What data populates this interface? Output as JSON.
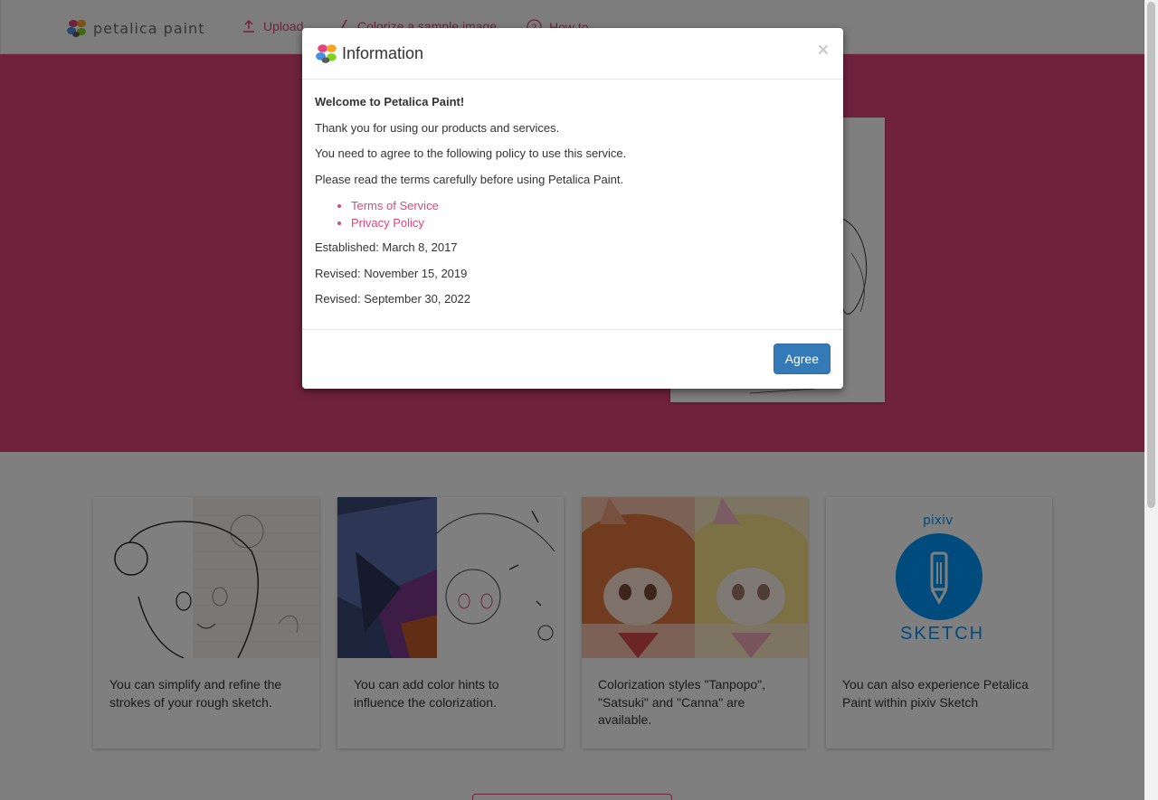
{
  "navbar": {
    "brand": "petalica paint",
    "items": [
      {
        "label": "Upload",
        "icon": "upload-icon"
      },
      {
        "label": "Colorize a sample image",
        "icon": "pencil-icon"
      },
      {
        "label": "How to",
        "icon": "question-icon"
      }
    ]
  },
  "features": [
    {
      "text": "You can simplify and refine the strokes of your rough sketch."
    },
    {
      "text": "You can add color hints to influence the colorization."
    },
    {
      "text": "Colorization styles \"Tanpopo\", \"Satsuki\" and \"Canna\" are available."
    },
    {
      "text": "You can also experience Petalica Paint within pixiv Sketch"
    }
  ],
  "pixiv_card": {
    "top": "pixiv",
    "bottom": "SKETCH"
  },
  "modal": {
    "title": "Information",
    "close": "×",
    "welcome": "Welcome to Petalica Paint!",
    "p1": "Thank you for using our products and services.",
    "p2": "You need to agree to the following policy to use this service.",
    "p3": "Please read the terms carefully before using Petalica Paint.",
    "links": [
      "Terms of Service",
      "Privacy Policy"
    ],
    "established": "Established: March 8, 2017",
    "revised1": "Revised: November 15, 2019",
    "revised2": "Revised: September 30, 2022",
    "agree": "Agree"
  },
  "colors": {
    "accent": "#e0457b",
    "primary": "#337ab7",
    "pixiv_blue": "#0096fa"
  }
}
